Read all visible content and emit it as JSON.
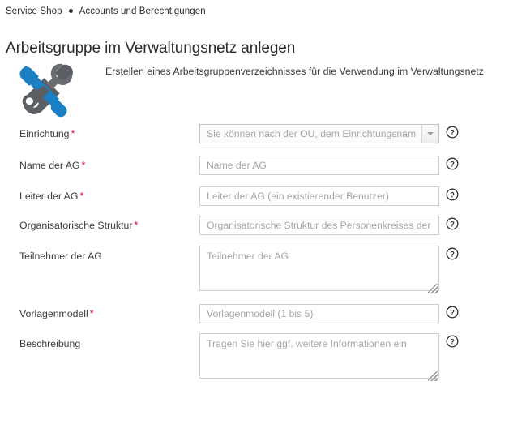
{
  "breadcrumb": {
    "items": [
      "Service Shop",
      "Accounts und Berechtigungen"
    ],
    "separator_icon": "bullet-separator-icon"
  },
  "page": {
    "title": "Arbeitsgruppe im Verwaltungsnetz anlegen",
    "intro": "Erstellen eines Arbeitsgruppenverzeichnisses für die Verwendung im Verwaltungsnetz",
    "icon": "tools-screwdriver-wrench-icon"
  },
  "colors": {
    "required_asterisk": "#cc0066",
    "icon_blue": "#1b7fc4",
    "icon_gray": "#5b5f63",
    "input_border": "#cfcfcf",
    "placeholder_text": "#a6a6a6",
    "label_text": "#3c3c3c",
    "page_background": "#ffffff"
  },
  "form": {
    "required_marker": "*",
    "help_icon": "question-mark-circle-icon",
    "fields": [
      {
        "id": "einrichtung",
        "label": "Einrichtung",
        "required": true,
        "type": "select",
        "value": "",
        "placeholder": "Sie können nach der OU, dem Einrichtungsnamen o…",
        "dropdown_icon": "chevron-down-icon",
        "help": "question-mark-circle-icon"
      },
      {
        "id": "name-der-ag",
        "label": "Name der AG",
        "required": true,
        "type": "text",
        "value": "",
        "placeholder": "Name der AG",
        "help": "question-mark-circle-icon"
      },
      {
        "id": "leiter-der-ag",
        "label": "Leiter der AG",
        "required": true,
        "type": "text",
        "value": "",
        "placeholder": "Leiter der AG (ein existierender Benutzer)",
        "help": "question-mark-circle-icon"
      },
      {
        "id": "organisatorische-struktur",
        "label": "Organisatorische Struktur",
        "required": true,
        "type": "text",
        "value": "",
        "placeholder": "Organisatorische Struktur des Personenkreises der zur",
        "help": "question-mark-circle-icon"
      },
      {
        "id": "teilnehmer-der-ag",
        "label": "Teilnehmer der AG",
        "required": false,
        "type": "textarea",
        "value": "",
        "placeholder": "Teilnehmer der AG",
        "help": "question-mark-circle-icon"
      },
      {
        "id": "vorlagenmodell",
        "label": "Vorlagenmodell",
        "required": true,
        "type": "text",
        "value": "",
        "placeholder": "Vorlagenmodell (1 bis 5)",
        "help": "question-mark-circle-icon"
      },
      {
        "id": "beschreibung",
        "label": "Beschreibung",
        "required": false,
        "type": "textarea",
        "value": "",
        "placeholder": "Tragen Sie hier ggf. weitere Informationen ein",
        "help": "question-mark-circle-icon"
      }
    ]
  }
}
